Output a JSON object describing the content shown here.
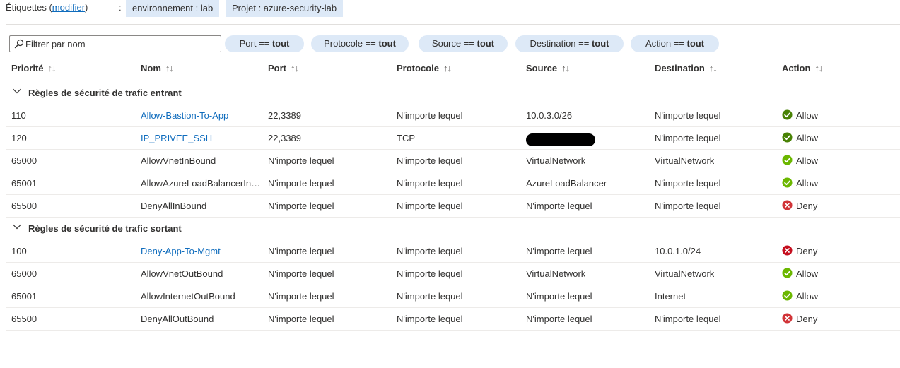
{
  "tags": {
    "label": "Étiquettes",
    "open_paren": " (",
    "edit_link": "modifier",
    "close_paren": ")",
    "colon": ":",
    "chips": [
      "environnement : lab",
      "Projet : azure-security-lab"
    ]
  },
  "filter": {
    "placeholder": "Filtrer par nom",
    "value": ""
  },
  "pills": [
    {
      "prefix": "Port == ",
      "value": "tout"
    },
    {
      "prefix": "Protocole == ",
      "value": "tout"
    },
    {
      "prefix": "Source == ",
      "value": "tout"
    },
    {
      "prefix": "Destination == ",
      "value": "tout"
    },
    {
      "prefix": "Action == ",
      "value": "tout"
    }
  ],
  "columns": [
    "Priorité",
    "Nom",
    "Port",
    "Protocole",
    "Source",
    "Destination",
    "Action"
  ],
  "sort_glyph": "↑↓",
  "groups": [
    {
      "title": "Règles de sécurité de trafic entrant",
      "rows": [
        {
          "priority": "110",
          "name": "Allow-Bastion-To-App",
          "link": true,
          "port": "22,3389",
          "protocol": "N'importe lequel",
          "source": "10.0.3.0/26",
          "destination": "N'importe lequel",
          "action": "Allow",
          "action_type": "allow-strong"
        },
        {
          "priority": "120",
          "name": "IP_PRIVEE_SSH",
          "link": true,
          "port": "22,3389",
          "protocol": "TCP",
          "source": "",
          "source_redacted": true,
          "destination": "N'importe lequel",
          "action": "Allow",
          "action_type": "allow-strong"
        },
        {
          "priority": "65000",
          "name": "AllowVnetInBound",
          "link": false,
          "port": "N'importe lequel",
          "protocol": "N'importe lequel",
          "source": "VirtualNetwork",
          "destination": "VirtualNetwork",
          "action": "Allow",
          "action_type": "allow-muted"
        },
        {
          "priority": "65001",
          "name": "AllowAzureLoadBalancerInB...",
          "link": false,
          "port": "N'importe lequel",
          "protocol": "N'importe lequel",
          "source": "AzureLoadBalancer",
          "destination": "N'importe lequel",
          "action": "Allow",
          "action_type": "allow-muted"
        },
        {
          "priority": "65500",
          "name": "DenyAllInBound",
          "link": false,
          "port": "N'importe lequel",
          "protocol": "N'importe lequel",
          "source": "N'importe lequel",
          "destination": "N'importe lequel",
          "action": "Deny",
          "action_type": "deny-muted"
        }
      ]
    },
    {
      "title": "Règles de sécurité de trafic sortant",
      "rows": [
        {
          "priority": "100",
          "name": "Deny-App-To-Mgmt",
          "link": true,
          "port": "N'importe lequel",
          "protocol": "N'importe lequel",
          "source": "N'importe lequel",
          "destination": "10.0.1.0/24",
          "action": "Deny",
          "action_type": "deny-strong"
        },
        {
          "priority": "65000",
          "name": "AllowVnetOutBound",
          "link": false,
          "port": "N'importe lequel",
          "protocol": "N'importe lequel",
          "source": "VirtualNetwork",
          "destination": "VirtualNetwork",
          "action": "Allow",
          "action_type": "allow-muted"
        },
        {
          "priority": "65001",
          "name": "AllowInternetOutBound",
          "link": false,
          "port": "N'importe lequel",
          "protocol": "N'importe lequel",
          "source": "N'importe lequel",
          "destination": "Internet",
          "action": "Allow",
          "action_type": "allow-muted"
        },
        {
          "priority": "65500",
          "name": "DenyAllOutBound",
          "link": false,
          "port": "N'importe lequel",
          "protocol": "N'importe lequel",
          "source": "N'importe lequel",
          "destination": "N'importe lequel",
          "action": "Deny",
          "action_type": "deny-muted"
        }
      ]
    }
  ],
  "icons": {
    "allow": "check-circle-icon",
    "deny": "error-circle-icon",
    "filter": "search-icon",
    "group": "chevron-down-icon"
  },
  "colors": {
    "allow_strong": "#498205",
    "allow_muted": "#6bb700",
    "deny_strong": "#c50f1f",
    "deny_muted": "#d13438",
    "link": "#0f6cbd",
    "chip": "#dde9f7"
  }
}
